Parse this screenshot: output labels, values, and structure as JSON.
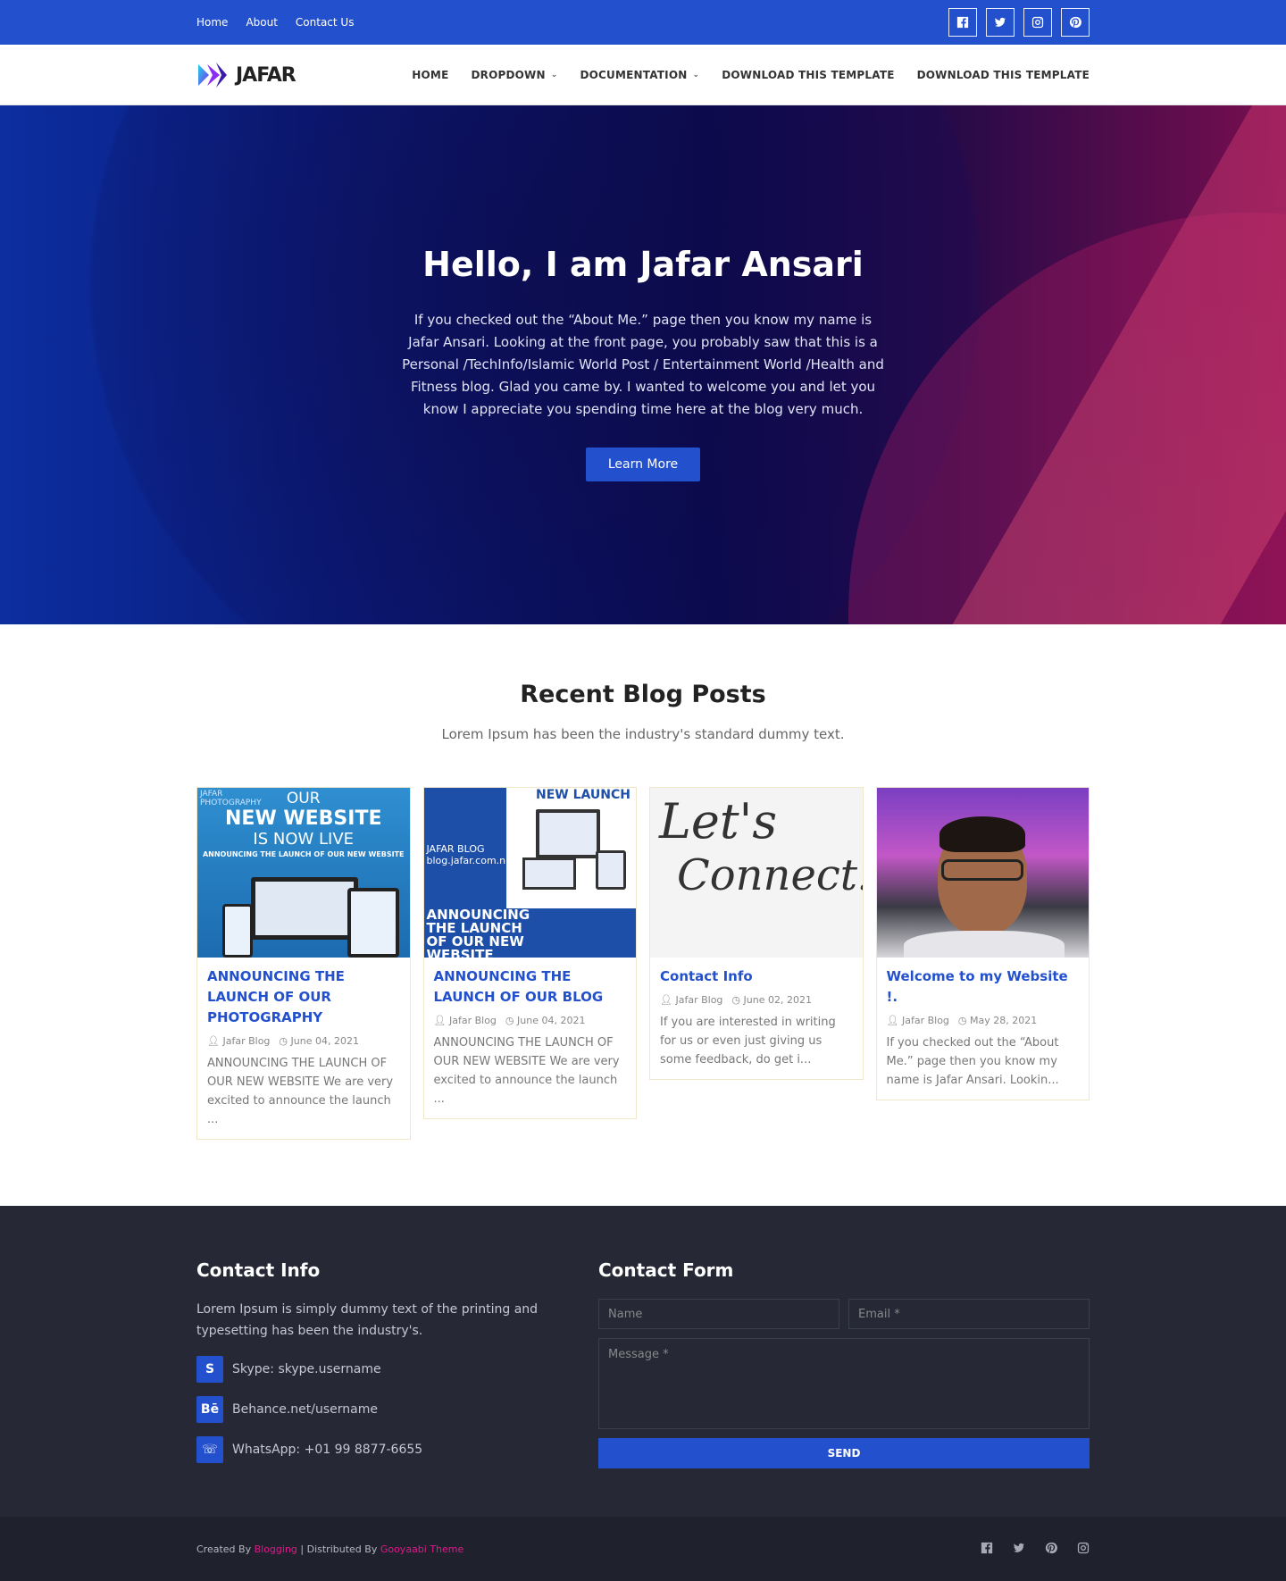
{
  "topbar": {
    "links": [
      "Home",
      "About",
      "Contact Us"
    ],
    "socials": [
      "facebook-icon",
      "twitter-icon",
      "instagram-icon",
      "pinterest-icon"
    ]
  },
  "nav": {
    "logo": "JAFAR",
    "items": [
      "HOME",
      "DROPDOWN",
      "DOCUMENTATION",
      "DOWNLOAD THIS TEMPLATE",
      "DOWNLOAD THIS TEMPLATE"
    ]
  },
  "hero": {
    "title": "Hello, I am Jafar Ansari",
    "text": "If you checked out the “About Me.” page then you know my name is Jafar Ansari. Looking at the front page, you probably saw that this is a Personal /TechInfo/Islamic World Post / Entertainment World /Health and Fitness blog. Glad you came by. I wanted to welcome you and let you know I appreciate you spending time here at the blog very much.",
    "button": "Learn More"
  },
  "blog": {
    "title": "Recent Blog Posts",
    "subtitle": "Lorem Ipsum has been the industry's standard dummy text.",
    "posts": [
      {
        "title": "ANNOUNCING THE LAUNCH OF OUR PHOTOGRAPHY",
        "author": "Jafar Blog",
        "date": "June 04, 2021",
        "excerpt": "ANNOUNCING THE LAUNCH OF OUR NEW WEBSITE We are very excited to announce the launch ...",
        "thumb": {
          "l1": "JAFAR",
          "l2": "PHOTOGRAPHY",
          "l3": "OUR",
          "l4": "NEW WEBSITE",
          "l5": "IS NOW LIVE",
          "l6": "ANNOUNCING THE LAUNCH OF OUR NEW WEBSITE"
        }
      },
      {
        "title": "ANNOUNCING THE LAUNCH OF OUR BLOG",
        "author": "Jafar Blog",
        "date": "June 04, 2021",
        "excerpt": "ANNOUNCING THE LAUNCH OF OUR NEW WEBSITE We are very excited to announce the launch ...",
        "thumb": {
          "l1": "NEW LAUNCH",
          "l2": "JAFAR BLOG",
          "l3": "blog.jafar.com.np",
          "l4": "ANNOUNCING THE LAUNCH OF OUR NEW WEBSITE"
        }
      },
      {
        "title": "Contact Info",
        "author": "Jafar Blog",
        "date": "June 02, 2021",
        "excerpt": "If you are interested in writing for us or even just giving us some feedback, do get i...",
        "thumb": {
          "l1": "Let's",
          "l2": "Connect!"
        }
      },
      {
        "title": "Welcome to my Website !.",
        "author": "Jafar Blog",
        "date": "May 28, 2021",
        "excerpt": "If you checked out the “About Me.” page then you know my name is Jafar Ansari.  Lookin..."
      }
    ]
  },
  "contact": {
    "title": "Contact Info",
    "desc": "Lorem Ipsum is simply dummy text of the printing and typesetting has been the industry's.",
    "items": [
      {
        "icon": "skype-icon",
        "glyph": "S",
        "text": "Skype: skype.username"
      },
      {
        "icon": "behance-icon",
        "glyph": "Bē",
        "text": "Behance.net/username"
      },
      {
        "icon": "whatsapp-icon",
        "glyph": "☏",
        "text": "WhatsApp: +01 99 8877-6655"
      }
    ]
  },
  "form": {
    "title": "Contact Form",
    "name_placeholder": "Name",
    "email_placeholder": "Email *",
    "message_placeholder": "Message *",
    "send": "SEND"
  },
  "footer": {
    "created_by": "Created By",
    "blogging": "Blogging",
    "distributed_by": "| Distributed By",
    "theme": "Gooyaabi Theme",
    "socials": [
      "facebook-icon",
      "twitter-icon",
      "pinterest-icon",
      "instagram-icon"
    ]
  },
  "colors": {
    "primary": "#2350cc",
    "footer": "#262836",
    "link_pink": "#e0188a"
  }
}
